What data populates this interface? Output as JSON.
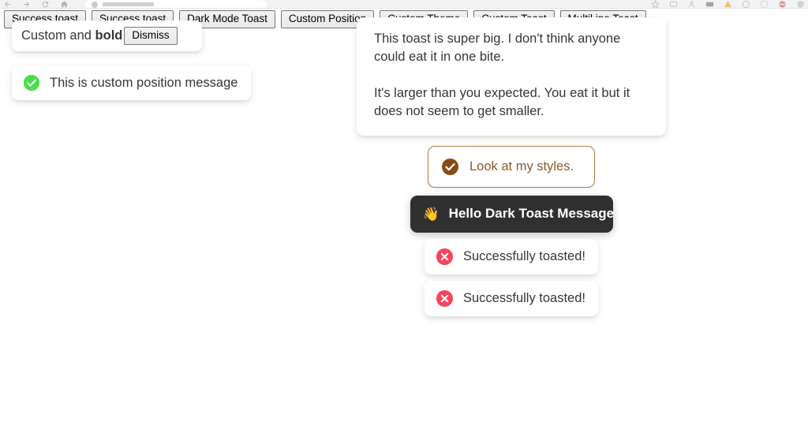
{
  "browser": {
    "nav_icons": [
      "back-arrow-icon",
      "forward-arrow-icon",
      "reload-icon",
      "home-icon"
    ],
    "toolbar_icons": [
      "bookmark-icon",
      "downloads-icon",
      "profile-icon",
      "screen-icon",
      "extension-icon",
      "history-icon",
      "shield-icon",
      "block-icon",
      "sync-icon"
    ],
    "tab_title": ""
  },
  "toolbar": {
    "buttons": [
      {
        "label": "Success toast",
        "name": "success-toast-button-1"
      },
      {
        "label": "Success toast",
        "name": "success-toast-button-2"
      },
      {
        "label": "Dark Mode Toast",
        "name": "dark-mode-toast-button"
      },
      {
        "label": "Custom Position",
        "name": "custom-position-button"
      },
      {
        "label": "Custom Theme",
        "name": "custom-theme-button"
      },
      {
        "label": "Custom Toast",
        "name": "custom-toast-button"
      },
      {
        "label": "Multil ine Toast",
        "name": "multiline-toast-button"
      }
    ]
  },
  "toasts": {
    "custom_bold": {
      "text_prefix": "Custom and ",
      "text_bold": "bold",
      "dismiss_label": "Dismiss"
    },
    "custom_position": {
      "message": "This is custom position message",
      "icon": "success-check-icon",
      "icon_color": "#4ade4a"
    },
    "multiline": {
      "paragraph_1": "This toast is super big. I don't think anyone could eat it in one bite.",
      "paragraph_2": "It's larger than you expected. You eat it but it does not seem to get smaller."
    },
    "custom_theme": {
      "message": "Look at my styles.",
      "icon": "success-check-icon",
      "accent_color": "#8a4b16",
      "border_color": "#b5793f",
      "text_color": "#8a5a2b"
    },
    "dark": {
      "message": "Hello Dark Toast Message",
      "emoji": "👋",
      "background_color": "#303030",
      "text_color": "#ffffff"
    },
    "errors": [
      {
        "message": "Successfully toasted!",
        "icon": "error-x-icon",
        "icon_color": "#f4465a"
      },
      {
        "message": "Successfully toasted!",
        "icon": "error-x-icon",
        "icon_color": "#f4465a"
      }
    ]
  }
}
